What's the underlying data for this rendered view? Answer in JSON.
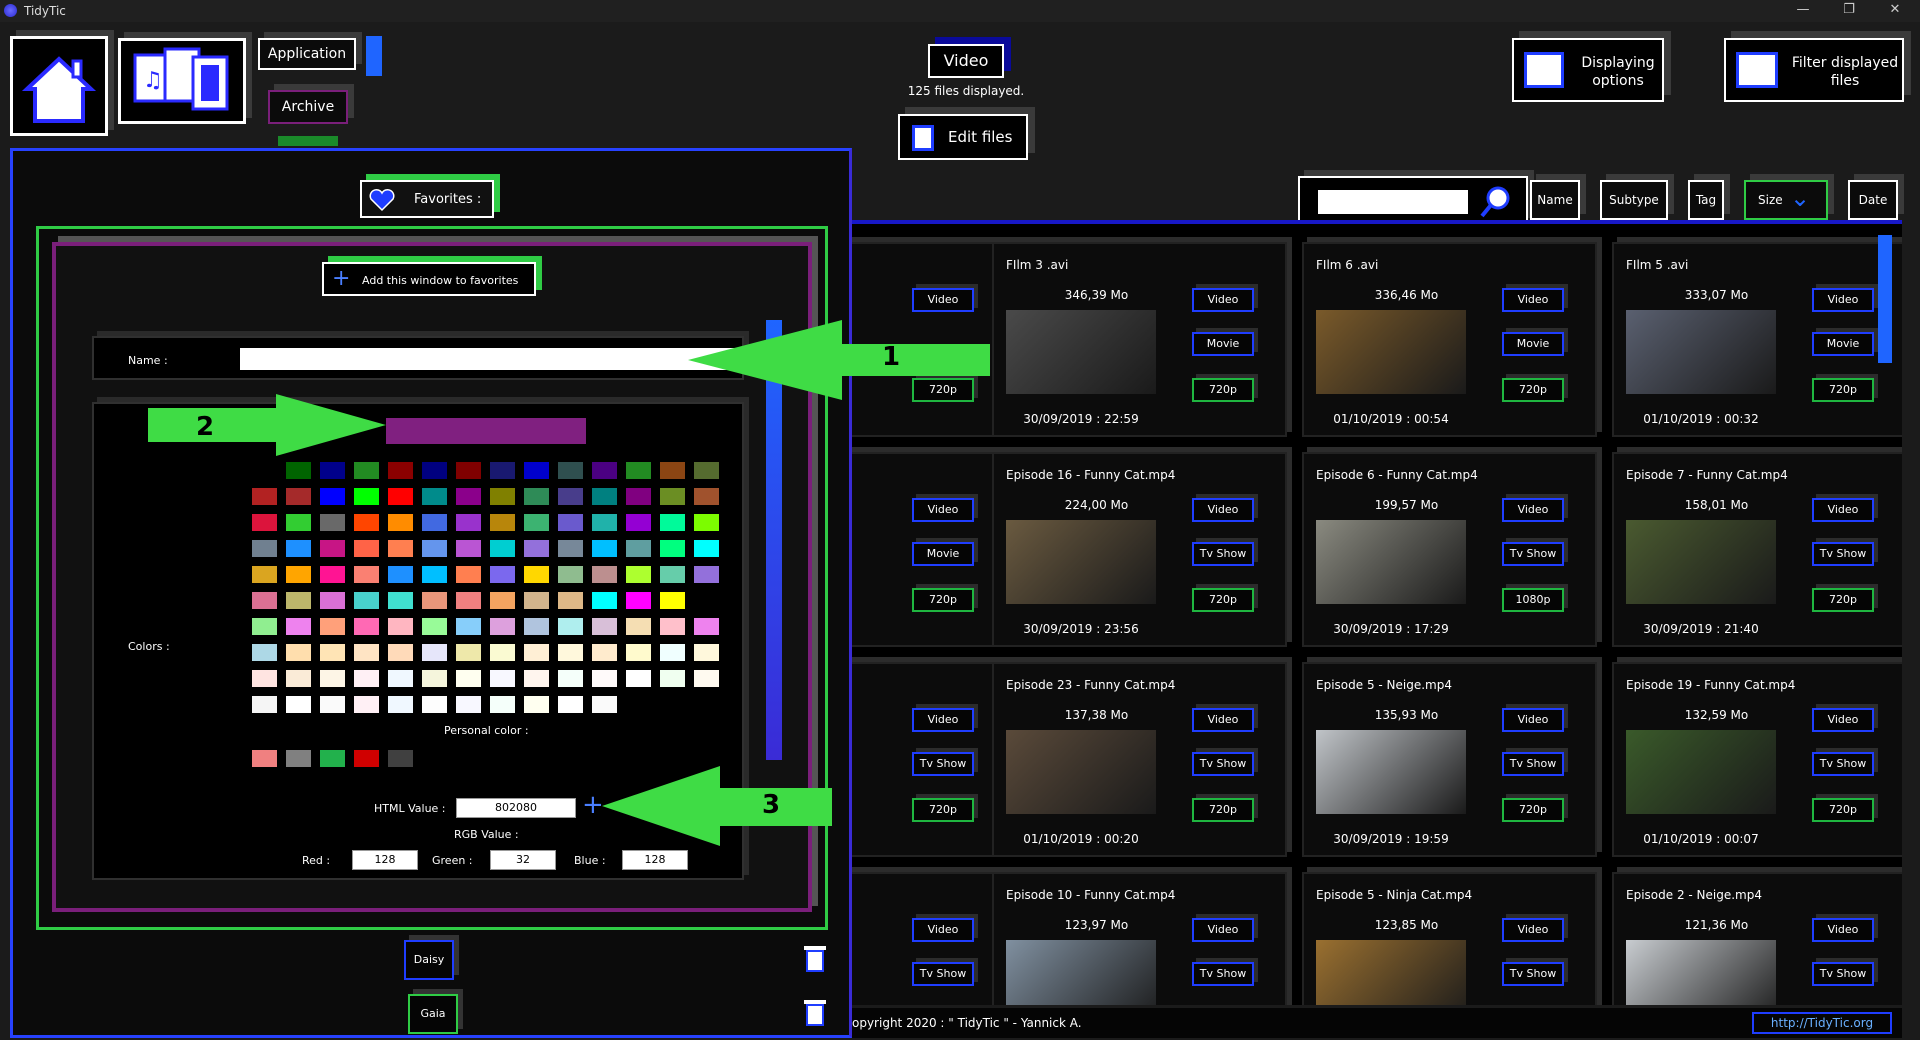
{
  "window": {
    "title": "TidyTic"
  },
  "header": {
    "nav": {
      "application": "Application",
      "archive": "Archive"
    },
    "category": {
      "label": "Video",
      "count_text": "125 files displayed."
    },
    "edit_files": "Edit files",
    "displaying_options": "Displaying options",
    "filter_files": "Filter displayed files"
  },
  "sort": {
    "search_value": "",
    "buttons": [
      "Name",
      "Subtype",
      "Tag",
      "Size",
      "Date"
    ]
  },
  "colors": {
    "accent": "#1f3dff",
    "green": "#2fcc45",
    "selected": "#802080"
  },
  "files": [
    {
      "title": "FIlm 3 .avi",
      "size": "346,39 Mo",
      "date": "30/09/2019 : 22:59",
      "type": "Video",
      "subtype": "Movie",
      "res": "720p"
    },
    {
      "title": "FIlm 6 .avi",
      "size": "336,46 Mo",
      "date": "01/10/2019 : 00:54",
      "type": "Video",
      "subtype": "Movie",
      "res": "720p"
    },
    {
      "title": "FIlm 5 .avi",
      "size": "333,07 Mo",
      "date": "01/10/2019 : 00:32",
      "type": "Video",
      "subtype": "Movie",
      "res": "720p"
    },
    {
      "title": "Episode 16 - Funny Cat.mp4",
      "size": "224,00 Mo",
      "date": "30/09/2019 : 23:56",
      "type": "Video",
      "subtype": "Tv Show",
      "res": "720p"
    },
    {
      "title": "Episode 6 - Funny Cat.mp4",
      "size": "199,57 Mo",
      "date": "30/09/2019 : 17:29",
      "type": "Video",
      "subtype": "Tv Show",
      "res": "1080p"
    },
    {
      "title": "Episode 7 - Funny Cat.mp4",
      "size": "158,01 Mo",
      "date": "30/09/2019 : 21:40",
      "type": "Video",
      "subtype": "Tv Show",
      "res": "720p"
    },
    {
      "title": "Episode 23 - Funny Cat.mp4",
      "size": "137,38 Mo",
      "date": "01/10/2019 : 00:20",
      "type": "Video",
      "subtype": "Tv Show",
      "res": "720p"
    },
    {
      "title": "Episode 5 - Neige.mp4",
      "size": "135,93 Mo",
      "date": "30/09/2019 : 19:59",
      "type": "Video",
      "subtype": "Tv Show",
      "res": "720p"
    },
    {
      "title": "Episode 19 - Funny Cat.mp4",
      "size": "132,59 Mo",
      "date": "01/10/2019 : 00:07",
      "type": "Video",
      "subtype": "Tv Show",
      "res": "720p"
    },
    {
      "title": "Episode 10 - Funny Cat.mp4",
      "size": "123,97 Mo",
      "date": "",
      "type": "Video",
      "subtype": "Tv Show",
      "res": ""
    },
    {
      "title": "Episode 5 - Ninja Cat.mp4",
      "size": "123,85 Mo",
      "date": "",
      "type": "Video",
      "subtype": "Tv Show",
      "res": ""
    },
    {
      "title": "Episode 2 - Neige.mp4",
      "size": "121,36 Mo",
      "date": "",
      "type": "Video",
      "subtype": "Tv Show",
      "res": ""
    }
  ],
  "left_column_pills": [
    {
      "a": "Video",
      "b": "",
      "c": "720p"
    },
    {
      "a": "Video",
      "b": "Movie",
      "c": "720p"
    },
    {
      "a": "Video",
      "b": "Tv Show",
      "c": "720p"
    },
    {
      "a": "Video",
      "b": "Tv Show",
      "c": ""
    }
  ],
  "footer": {
    "copyright": "opyright 2020 : \" TidyTic \" - Yannick A.",
    "link": "http://TidyTic.org"
  },
  "favorites": {
    "title": "Favorites :",
    "add_button": "Add this window to favorites",
    "name_label": "Name :",
    "name_value": "",
    "colors_label": "Colors :",
    "personal_color_label": "Personal color :",
    "html_value_label": "HTML Value :",
    "html_value": "802080",
    "rgb_label": "RGB Value :",
    "red_label": "Red :",
    "red": "128",
    "green_label": "Green :",
    "green": "32",
    "blue_label": "Blue :",
    "blue": "128",
    "items": [
      {
        "name": "Daisy",
        "color": "#1f3dff"
      },
      {
        "name": "Gaia",
        "color": "#2fcc45"
      }
    ]
  },
  "annotations": {
    "a1": "1",
    "a2": "2",
    "a3": "3"
  },
  "palette": {
    "row0": [
      "#006400",
      "#00008b",
      "#228b22",
      "#8b0000",
      "#000080",
      "#800000",
      "#191970",
      "#0000cd",
      "#2f4f4f",
      "#4b0082",
      "#228b22",
      "#8b4513",
      "#556b2f"
    ],
    "row1": [
      "#b22222",
      "#a52a2a",
      "#0000ff",
      "#00ff00",
      "#ff0000",
      "#008b8b",
      "#8b008b",
      "#808000",
      "#2e8b57",
      "#483d8b",
      "#008080",
      "#800080",
      "#6b8e23",
      "#a0522d"
    ],
    "row2": [
      "#dc143c",
      "#32cd32",
      "#696969",
      "#ff4500",
      "#ff8c00",
      "#4169e1",
      "#9932cc",
      "#b8860b",
      "#3cb371",
      "#6a5acd",
      "#20b2aa",
      "#9400d3",
      "#00fa9a",
      "#7cfc00"
    ],
    "row3": [
      "#708090",
      "#1e90ff",
      "#c71585",
      "#ff6347",
      "#ff7f50",
      "#6495ed",
      "#ba55d3",
      "#00ced1",
      "#9370db",
      "#778899",
      "#00bfff",
      "#5f9ea0",
      "#00ff7f",
      "#00ffff"
    ],
    "row4": [
      "#daa520",
      "#ffa500",
      "#ff1493",
      "#fa8072",
      "#1e90ff",
      "#00bfff",
      "#ff7f50",
      "#7b68ee",
      "#ffd700",
      "#8fbc8f",
      "#bc8f8f",
      "#adff2f",
      "#66cdaa",
      "#9370db"
    ],
    "row5": [
      "#db7093",
      "#bdb76b",
      "#da70d6",
      "#48d1cc",
      "#40e0d0",
      "#e9967a",
      "#f08080",
      "#f4a460",
      "#d2b48c",
      "#deb887",
      "#00ffff",
      "#ff00ff",
      "#ffff00"
    ],
    "row6": [
      "#90ee90",
      "#ee82ee",
      "#ffa07a",
      "#ff69b4",
      "#ffb6c1",
      "#98fb98",
      "#87cefa",
      "#dda0dd",
      "#b0c4de",
      "#afeeee",
      "#d8bfd8",
      "#f5deb3",
      "#ffc0cb",
      "#ee82ee"
    ],
    "row7": [
      "#add8e6",
      "#ffdead",
      "#ffe4b5",
      "#ffe4c4",
      "#ffdab9",
      "#e6e6fa",
      "#eee8aa",
      "#fafad2",
      "#ffefd5",
      "#fff8dc",
      "#ffebcd",
      "#fffacd",
      "#f0ffff",
      "#fff8dc"
    ],
    "row8": [
      "#ffe4e1",
      "#faebd7",
      "#fdf5e6",
      "#fff0f5",
      "#f0f8ff",
      "#f5f5dc",
      "#fffff0",
      "#f8f8ff",
      "#fff5ee",
      "#f5fffa",
      "#fffafa",
      "#ffffff",
      "#f0fff0",
      "#fffaf0"
    ],
    "row9": [
      "#f5f5f5",
      "#ffffff",
      "#fafafa",
      "#fff0f5",
      "#f0f8ff",
      "#fdfdfd",
      "#f8f8ff",
      "#f5fffa",
      "#fffff0",
      "#ffffff",
      "#fafafa"
    ],
    "personal": [
      "#f08080",
      "#808080",
      "#22b14c",
      "#d00000",
      "#404040"
    ]
  }
}
